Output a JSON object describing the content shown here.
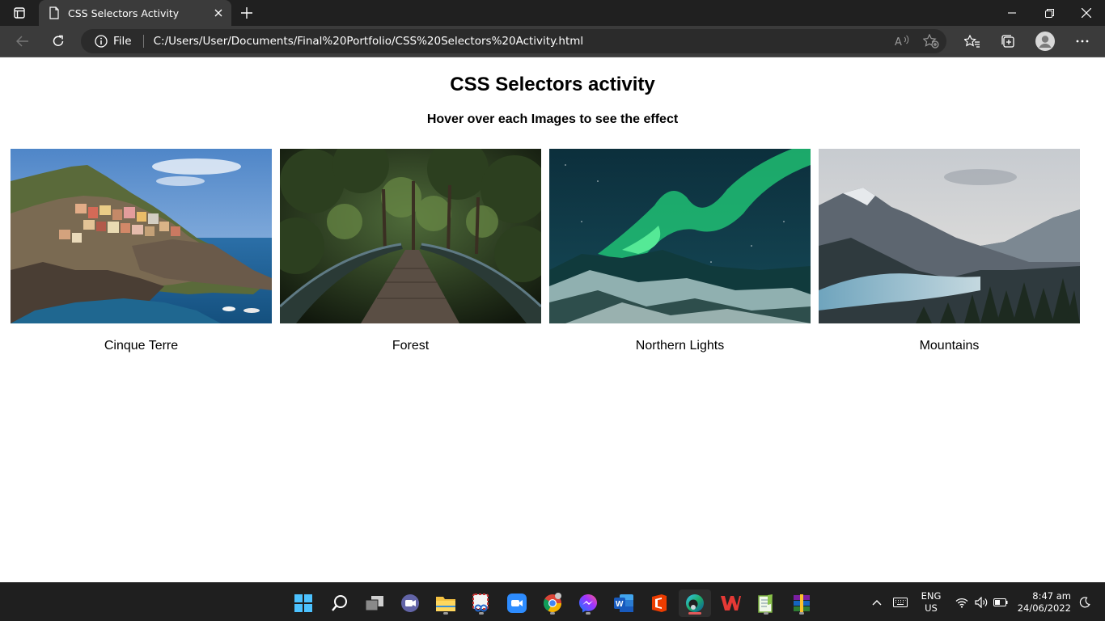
{
  "browser": {
    "tab_title": "CSS Selectors Activity",
    "address_scheme_label": "File",
    "address_url": "C:/Users/User/Documents/Final%20Portfolio/CSS%20Selectors%20Activity.html",
    "icons": [
      "tab-actions-icon",
      "page-icon",
      "close-icon",
      "plus-icon",
      "minimize-icon",
      "restore-icon",
      "close-window-icon",
      "back-icon",
      "refresh-icon",
      "info-icon",
      "read-aloud-icon",
      "add-favorite-icon",
      "favorites-icon",
      "collections-icon",
      "profile-icon",
      "more-icon"
    ]
  },
  "page": {
    "title": "CSS Selectors activity",
    "subtitle": "Hover over each Images to see the effect",
    "cards": [
      {
        "caption": "Cinque Terre",
        "image": "coastal-village-photo"
      },
      {
        "caption": "Forest",
        "image": "forest-bridge-photo"
      },
      {
        "caption": "Northern Lights",
        "image": "aurora-photo"
      },
      {
        "caption": "Mountains",
        "image": "mountain-lake-photo"
      }
    ]
  },
  "taskbar": {
    "apps": [
      "start",
      "search",
      "task-view",
      "teams-chat",
      "file-explorer",
      "snipping-tool",
      "zoom",
      "chrome",
      "messenger",
      "word",
      "office",
      "edge",
      "wps",
      "notepad-plus",
      "winrar"
    ],
    "language": {
      "line1": "ENG",
      "line2": "US"
    },
    "time": "8:47 am",
    "date": "24/06/2022"
  },
  "colors": {
    "chrome_dark": "#202020",
    "chrome_tab": "#3b3b3b",
    "address_bar": "#2b2b2b",
    "taskbar": "#1f1f1f",
    "page_bg": "#ffffff"
  }
}
